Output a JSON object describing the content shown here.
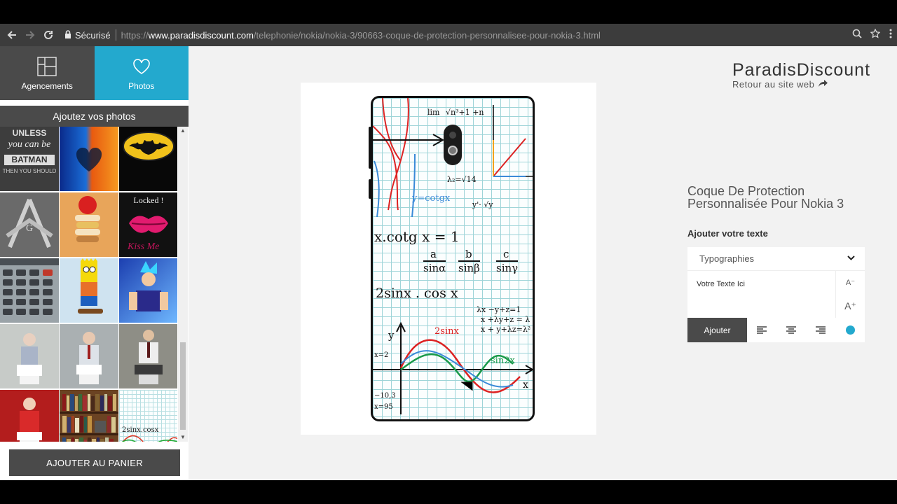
{
  "browser": {
    "secure_label": "Sécurisé",
    "url_scheme": "https://",
    "url_host": "www.paradisdiscount.com",
    "url_path": "/telephonie/nokia/nokia-3/90663-coque-de-protection-personnalisee-pour-nokia-3.html"
  },
  "sidebar": {
    "tabs": [
      {
        "label": "Agencements",
        "icon": "layout-grid-icon"
      },
      {
        "label": "Photos",
        "icon": "heart-icon"
      }
    ],
    "photos_header": "Ajoutez vos photos",
    "thumbs": {
      "batman_line1": "UNLESS",
      "batman_line2": "you can be",
      "batman_line3": "BATMAN",
      "batman_line4": "THEN YOU SHOULD",
      "locked": "Locked !",
      "kiss_me": "Kiss Me",
      "math_thumb": "2sinx.cosx"
    },
    "add_to_cart": "AJOUTER AU PANIER"
  },
  "preview": {
    "formulas": {
      "lim": "lim",
      "lim_frac": "√n³+1 +n",
      "cotg": "y=cotgx",
      "lambda": "λ₂=√14",
      "xcotg": "x.cotg x = 1",
      "sine_ratio_a": "a",
      "sine_ratio_sin_a": "sinα",
      "sine_ratio_b": "b",
      "sine_ratio_sin_b": "sinβ",
      "sine_ratio_c": "c",
      "sine_ratio_sin_c": "sinγ",
      "two_sin": "2sinx . cos x",
      "system1": "λx −y+z=1",
      "system2": "x +λy+z = λ",
      "system3": "x + y+λz=λ²",
      "label_2sinx": "2sinx",
      "label_sin2x": "sin2x",
      "axis_y": "y",
      "axis_x": "x",
      "ty": "y'· √y",
      "tick_2": "x=2",
      "tick_103": "−10,3",
      "tick_95": "x=95"
    }
  },
  "brand": {
    "name": "ParadisDiscount",
    "back_link": "Retour au site web"
  },
  "product": {
    "title": "Coque De Protection Personnalisée Pour Nokia 3"
  },
  "text_editor": {
    "section_label": "Ajouter votre texte",
    "typography_select": "Typographies",
    "text_value": "Votre Texte Ici",
    "font_smaller": "A⁻",
    "font_larger": "A⁺",
    "add_button": "Ajouter",
    "color": "#23a9ce"
  },
  "colors": {
    "accent": "#23a9ce",
    "dark": "#4a4a4a"
  }
}
